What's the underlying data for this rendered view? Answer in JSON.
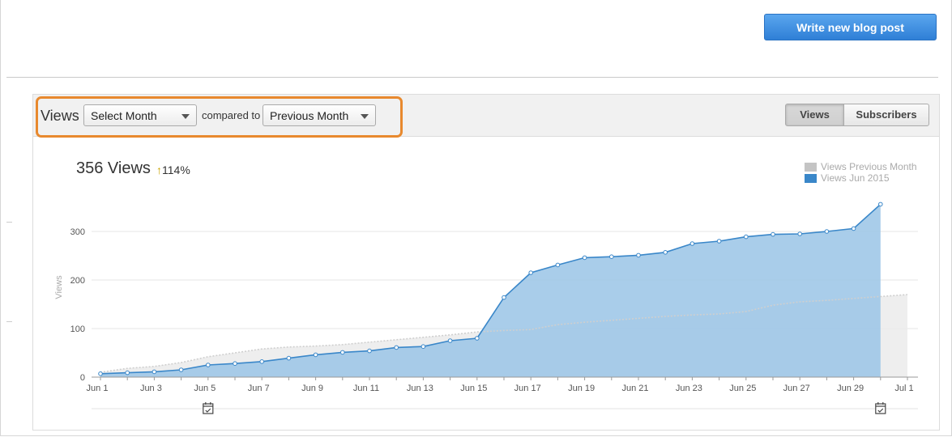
{
  "header": {
    "write_button_label": "Write new blog post"
  },
  "stats_panel": {
    "views_label": "Views",
    "period_select": {
      "value": "Select Month"
    },
    "compared_to_label": "compared to",
    "compare_select": {
      "value": "Previous Month"
    },
    "toggle": {
      "views_label": "Views",
      "subscribers_label": "Subscribers",
      "active": "Views"
    }
  },
  "summary": {
    "total_label": "356 Views",
    "change_arrow": "↑",
    "change_value": "114%"
  },
  "colors": {
    "current_series": "#3a87c9",
    "current_fill": "#9ac4e6",
    "previous_series": "#bdbdbd",
    "previous_fill": "#ebebeb",
    "highlight": "#e8892e"
  },
  "icons": {
    "calendar_marker": "calendar-check-icon"
  },
  "chart_data": {
    "type": "area",
    "ylabel": "Views",
    "ylim": [
      0,
      360
    ],
    "yticks": [
      0,
      100,
      200,
      300
    ],
    "grid": true,
    "legend_position": "top-right",
    "x": [
      "Jun 1",
      "Jun 2",
      "Jun 3",
      "Jun 4",
      "Jun 5",
      "Jun 6",
      "Jun 7",
      "Jun 8",
      "Jun 9",
      "Jun 10",
      "Jun 11",
      "Jun 12",
      "Jun 13",
      "Jun 14",
      "Jun 15",
      "Jun 16",
      "Jun 17",
      "Jun 18",
      "Jun 19",
      "Jun 20",
      "Jun 21",
      "Jun 22",
      "Jun 23",
      "Jun 24",
      "Jun 25",
      "Jun 26",
      "Jun 27",
      "Jun 28",
      "Jun 29",
      "Jun 30",
      "Jul 1"
    ],
    "xtick_labels": [
      "Jun 1",
      "Jun 3",
      "Jun 5",
      "Jun 7",
      "Jun 9",
      "Jun 11",
      "Jun 13",
      "Jun 15",
      "Jun 17",
      "Jun 19",
      "Jun 21",
      "Jun 23",
      "Jun 25",
      "Jun 27",
      "Jun 29",
      "Jul 1"
    ],
    "series": [
      {
        "name": "Views Previous Month",
        "values": [
          10,
          18,
          22,
          30,
          42,
          50,
          58,
          62,
          64,
          67,
          72,
          77,
          82,
          87,
          93,
          96,
          98,
          108,
          113,
          117,
          121,
          125,
          128,
          130,
          135,
          148,
          155,
          158,
          162,
          166,
          170
        ]
      },
      {
        "name": "Views Jun 2015",
        "values": [
          7,
          9,
          11,
          15,
          25,
          28,
          32,
          39,
          46,
          51,
          54,
          61,
          63,
          75,
          80,
          164,
          215,
          231,
          246,
          248,
          251,
          257,
          275,
          280,
          289,
          294,
          295,
          300,
          306,
          356,
          null
        ]
      }
    ],
    "event_markers": [
      "Jun 5",
      "Jun 30"
    ]
  }
}
